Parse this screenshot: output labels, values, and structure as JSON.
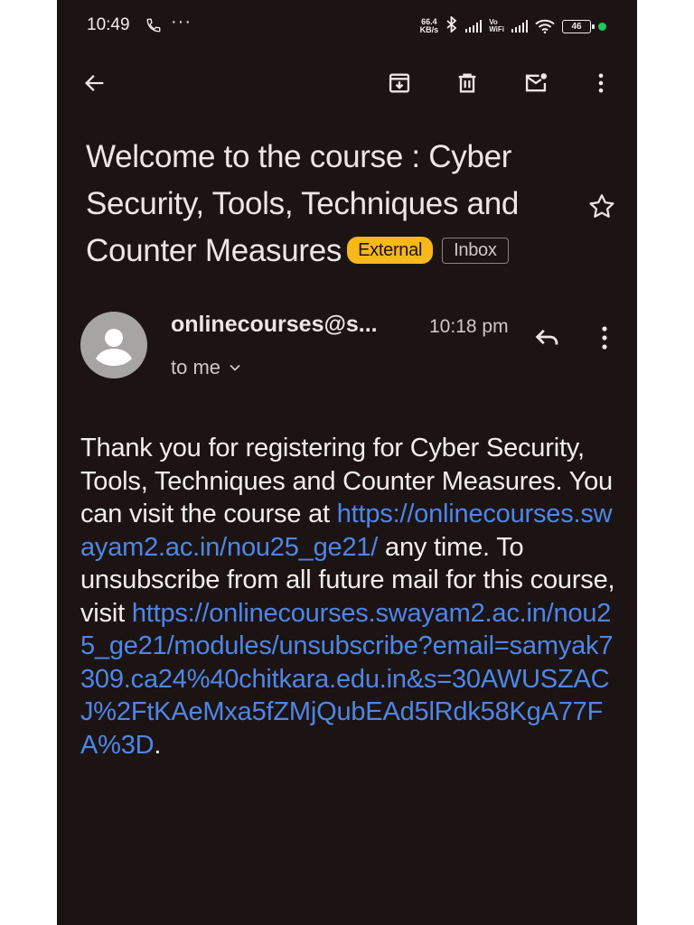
{
  "status_bar": {
    "time": "10:49",
    "dots": "···",
    "net_speed_value": "66.4",
    "net_speed_unit": "KB/s",
    "vo_label": "Vo",
    "wifi_label": "WiFi",
    "battery": "46",
    "dot_color": "#22c55e"
  },
  "toolbar": {
    "back_icon": "arrow-left-icon",
    "archive_icon": "archive-icon",
    "delete_icon": "trash-icon",
    "mark_unread_icon": "mail-unread-icon",
    "more_icon": "more-vert-icon"
  },
  "email": {
    "subject": "Welcome to the course : Cyber Security, Tools, Techniques and Counter Measures",
    "label_external": "External",
    "label_inbox": "Inbox",
    "external_color": "#f6b81a",
    "sender": "onlinecourses@s...",
    "time": "10:18 pm",
    "recipient": "to me",
    "body_intro": "Thank you for registering for Cyber Security, Tools, Techniques and Counter Measures. You can visit the course at ",
    "link1": "https://onlinecourses.swayam2.ac.in/nou25_ge21/",
    "body_mid": " any time. To unsubscribe from all future mail for this course, visit ",
    "link2": "https://onlinecourses.swayam2.ac.in/nou25_ge21/modules/unsubscribe?email=samyak7309.ca24%40chitkara.edu.in&s=30AWUSZACJ%2FtKAeMxa5fZMjQubEAd5lRdk58KgA77FA%3D",
    "body_end": ".",
    "link_color": "#4f86e8"
  }
}
